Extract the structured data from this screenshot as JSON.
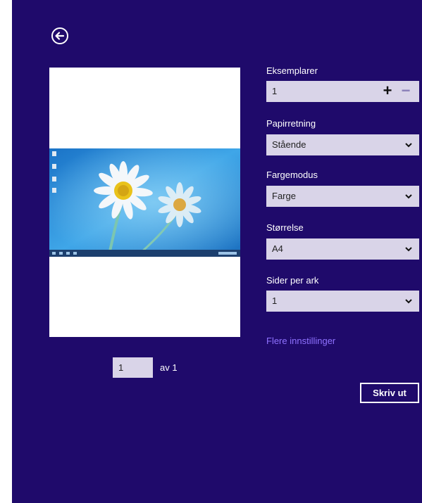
{
  "window": {
    "background_color": "#1f0a6b",
    "back_icon": "back-arrow-icon"
  },
  "preview": {
    "page_number": "1",
    "page_of": "av 1"
  },
  "settings": {
    "copies": {
      "label": "Eksemplarer",
      "value": "1",
      "plus": "+",
      "minus": "−"
    },
    "orientation": {
      "label": "Papirretning",
      "value": "Stående"
    },
    "color_mode": {
      "label": "Fargemodus",
      "value": "Farge"
    },
    "size": {
      "label": "Størrelse",
      "value": "A4"
    },
    "pages_per_sheet": {
      "label": "Sider per ark",
      "value": "1"
    },
    "more_link": "Flere innstillinger",
    "print_button": "Skriv ut"
  },
  "colors": {
    "accent_link": "#8f72ff",
    "field_bg": "#d9d4e8"
  }
}
